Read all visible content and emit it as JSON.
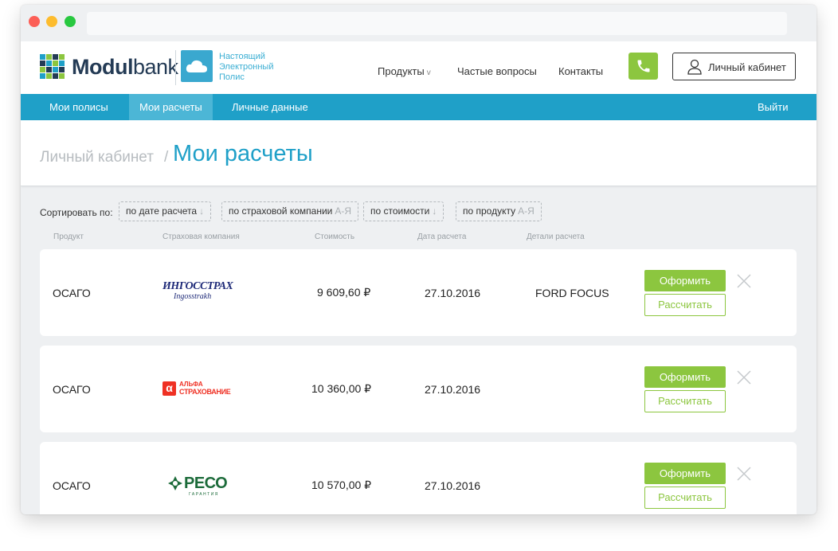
{
  "brand": {
    "name_bold": "Modul",
    "name_rest": "bank",
    "tagline_line1": "Настоящий",
    "tagline_line2": "Электронный",
    "tagline_line3": "Полис"
  },
  "nav": {
    "products": "Продукты",
    "products_chevron": "v",
    "faq": "Частые вопросы",
    "contacts": "Контакты",
    "cabinet": "Личный кабинет"
  },
  "tabs": {
    "policies": "Мои полисы",
    "calculations": "Мои расчеты",
    "personal": "Личные данные",
    "logout": "Выйти"
  },
  "breadcrumb": {
    "parent": "Личный кабинет",
    "separator": "/",
    "current": "Мои расчеты"
  },
  "sort": {
    "label": "Сортировать по:",
    "options": [
      {
        "label": "по дате расчета",
        "hint": "↓"
      },
      {
        "label": "по страховой компании",
        "hint": "А-Я"
      },
      {
        "label": "по стоимости",
        "hint": "↓"
      },
      {
        "label": "по продукту",
        "hint": "А-Я"
      }
    ]
  },
  "columns": {
    "product": "Продукт",
    "company": "Страховая компания",
    "price": "Стоимость",
    "date": "Дата расчета",
    "details": "Детали расчета"
  },
  "rows": [
    {
      "product": "ОСАГО",
      "company_logo_line1": "ИНГОССТРАХ",
      "company_logo_line2": "Ingosstrakh",
      "price": "9 609,60 ₽",
      "date": "27.10.2016",
      "details": "FORD FOCUS",
      "issue": "Оформить",
      "calc": "Рассчитать"
    },
    {
      "product": "ОСАГО",
      "company_logo_line1": "АЛЬФА",
      "company_logo_line2": "СТРАХОВАНИЕ",
      "price": "10 360,00 ₽",
      "date": "27.10.2016",
      "details": "",
      "issue": "Оформить",
      "calc": "Рассчитать"
    },
    {
      "product": "ОСАГО",
      "company_logo_line1": "РЕСО",
      "company_logo_line2": "ГАРАНТИЯ",
      "price": "10 570,00 ₽",
      "date": "27.10.2016",
      "details": "",
      "issue": "Оформить",
      "calc": "Рассчитать"
    }
  ],
  "colors": {
    "accent_blue": "#1fa0c8",
    "accent_green": "#8cc63f",
    "alfa_red": "#ef3124",
    "reso_green": "#1c6b3a",
    "ingos_navy": "#1e2a78"
  },
  "icons": {
    "phone": "phone-icon",
    "user": "user-icon",
    "close": "close-icon",
    "cloud": "cloud-icon"
  }
}
